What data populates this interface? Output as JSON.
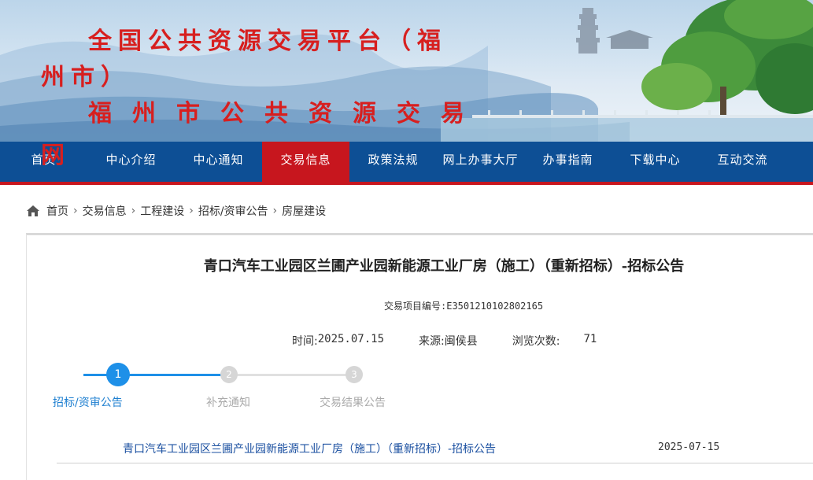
{
  "header": {
    "site_title_line1": "全国公共资源交易平台（福州市）",
    "site_title_line2": "福州市公共资源交易",
    "site_title_line2b": "网"
  },
  "nav": {
    "items": [
      {
        "label": "首页"
      },
      {
        "label": "中心介绍"
      },
      {
        "label": "中心通知"
      },
      {
        "label": "交易信息",
        "active": true
      },
      {
        "label": "政策法规"
      },
      {
        "label": "网上办事大厅"
      },
      {
        "label": "办事指南"
      },
      {
        "label": "下载中心"
      },
      {
        "label": "互动交流"
      }
    ]
  },
  "breadcrumb": {
    "icon": "home-icon",
    "items": [
      "首页",
      "交易信息",
      "工程建设",
      "招标/资审公告",
      "房屋建设"
    ],
    "separator": "›"
  },
  "article": {
    "title": "青口汽车工业园区兰圃产业园新能源工业厂房（施工）（重新招标）-招标公告",
    "project_code": "交易项目编号:E3501210102802165",
    "time_label": "时间:",
    "time_value": "2025.07.15",
    "source_label": "来源:",
    "source_value": "闽侯县",
    "views_label": "浏览次数:",
    "views_value": "71"
  },
  "steps": [
    {
      "number": "1",
      "label": "招标/资审公告",
      "active": true
    },
    {
      "number": "2",
      "label": "补充通知",
      "active": false
    },
    {
      "number": "3",
      "label": "交易结果公告",
      "active": false
    }
  ],
  "documents": [
    {
      "title": "青口汽车工业园区兰圃产业园新能源工业厂房（施工）（重新招标）-招标公告",
      "date": "2025-07-15"
    }
  ],
  "colors": {
    "nav_bg": "#0d4f95",
    "nav_active": "#c7161e",
    "title_red": "#d71f1f",
    "step_active": "#1e90e8",
    "link_blue": "#1a4fa0"
  }
}
